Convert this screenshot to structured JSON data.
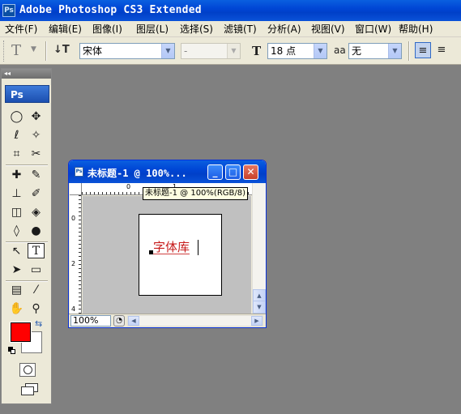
{
  "app": {
    "title": "Adobe Photoshop CS3 Extended",
    "logo_text": "Ps"
  },
  "menu": [
    "文件(F)",
    "编辑(E)",
    "图像(I)",
    "图层(L)",
    "选择(S)",
    "滤镜(T)",
    "分析(A)",
    "视图(V)",
    "窗口(W)",
    "帮助(H)"
  ],
  "options": {
    "tool_preset_icon": "T",
    "orientation_icon": "↓T",
    "font_family": "宋体",
    "font_style": "-",
    "font_size_icon": "T",
    "font_size": "18 点",
    "antialias_icon": "aa",
    "antialias": "无",
    "align_icons": [
      "align-left-icon",
      "align-center-icon"
    ]
  },
  "toolbox": {
    "collapse": "◂◂",
    "badge": "Ps",
    "foreground_color": "#ff0000",
    "background_color": "#ffffff"
  },
  "document": {
    "title": "未标题-1 @ 100%...",
    "tooltip": "未标题-1 @ 100%(RGB/8)",
    "canvas_text": "字体库",
    "text_color": "#c71b1b",
    "zoom": "100%",
    "ruler_h": [
      "0",
      "1"
    ],
    "ruler_v": [
      "0",
      "2",
      "4"
    ]
  }
}
